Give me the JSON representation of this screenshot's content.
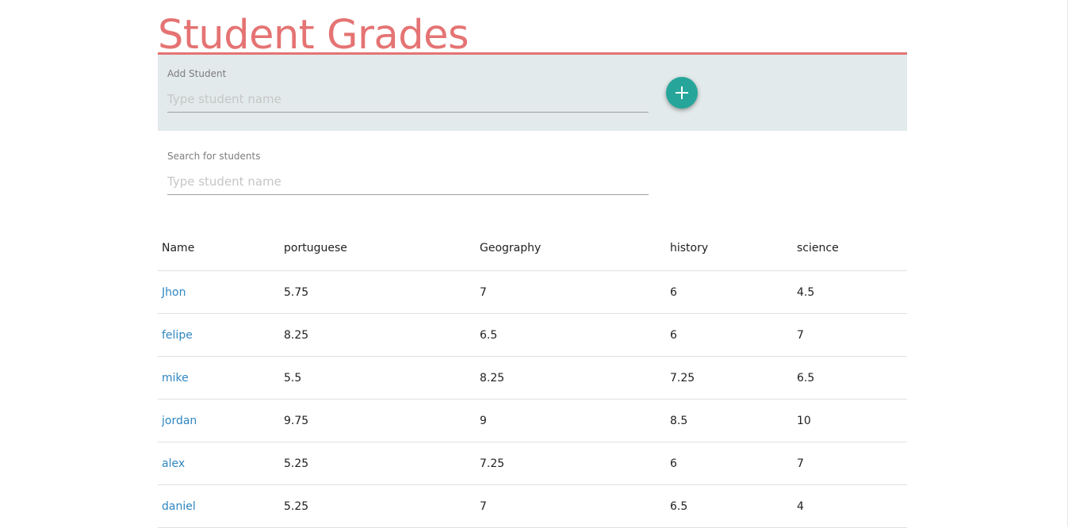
{
  "page": {
    "title": "Student Grades"
  },
  "add_student": {
    "label": "Add Student",
    "placeholder": "Type student name",
    "value": "",
    "button_icon": "plus-icon"
  },
  "search": {
    "label": "Search for students",
    "placeholder": "Type student name",
    "value": ""
  },
  "table": {
    "headers": [
      "Name",
      "portuguese",
      "Geography",
      "history",
      "science"
    ],
    "rows": [
      {
        "name": "Jhon",
        "portuguese": "5.75",
        "geography": "7",
        "history": "6",
        "science": "4.5"
      },
      {
        "name": "felipe",
        "portuguese": "8.25",
        "geography": "6.5",
        "history": "6",
        "science": "7"
      },
      {
        "name": "mike",
        "portuguese": "5.5",
        "geography": "8.25",
        "history": "7.25",
        "science": "6.5"
      },
      {
        "name": "jordan",
        "portuguese": "9.75",
        "geography": "9",
        "history": "8.5",
        "science": "10"
      },
      {
        "name": "alex",
        "portuguese": "5.25",
        "geography": "7.25",
        "history": "6",
        "science": "7"
      },
      {
        "name": "daniel",
        "portuguese": "5.25",
        "geography": "7",
        "history": "6.5",
        "science": "4"
      }
    ]
  },
  "colors": {
    "title_accent": "#e57373",
    "panel_background": "#e3eaeb",
    "add_button": "#26a69a",
    "student_link": "#2e86c1"
  }
}
